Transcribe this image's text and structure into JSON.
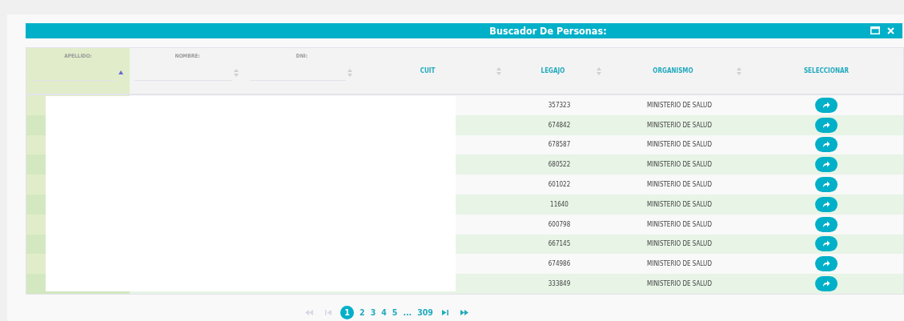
{
  "window": {
    "title": "Buscador De Personas:"
  },
  "table": {
    "columns": [
      {
        "label": "APELLIDO:",
        "kind": "filter",
        "sorted": true
      },
      {
        "label": "NOMBRE:",
        "kind": "filter",
        "sorted": false
      },
      {
        "label": "DNI:",
        "kind": "filter",
        "sorted": false
      },
      {
        "label": "CUIT",
        "kind": "plain",
        "sorted": false
      },
      {
        "label": "LEGAJO",
        "kind": "plain",
        "sorted": false
      },
      {
        "label": "ORGANISMO",
        "kind": "plain",
        "sorted": false
      },
      {
        "label": "SELECCIONAR",
        "kind": "action",
        "sorted": false
      }
    ],
    "rows": [
      {
        "legajo": "357323",
        "organismo": "MINISTERIO DE SALUD"
      },
      {
        "legajo": "674842",
        "organismo": "MINISTERIO DE SALUD"
      },
      {
        "legajo": "678587",
        "organismo": "MINISTERIO DE SALUD"
      },
      {
        "legajo": "680522",
        "organismo": "MINISTERIO DE SALUD"
      },
      {
        "legajo": "601022",
        "organismo": "MINISTERIO DE SALUD"
      },
      {
        "legajo": "11640",
        "organismo": "MINISTERIO DE SALUD"
      },
      {
        "legajo": "600798",
        "organismo": "MINISTERIO DE SALUD"
      },
      {
        "legajo": "667145",
        "organismo": "MINISTERIO DE SALUD"
      },
      {
        "legajo": "674986",
        "organismo": "MINISTERIO DE SALUD"
      },
      {
        "legajo": "333849",
        "organismo": "MINISTERIO DE SALUD"
      }
    ]
  },
  "pagination": {
    "first_disabled": true,
    "prev_disabled": true,
    "pages": [
      {
        "label": "1",
        "selected": true
      },
      {
        "label": "2",
        "selected": false
      },
      {
        "label": "3",
        "selected": false
      },
      {
        "label": "4",
        "selected": false
      },
      {
        "label": "5",
        "selected": false
      },
      {
        "label": "...",
        "selected": false
      },
      {
        "label": "309",
        "selected": false
      }
    ]
  }
}
